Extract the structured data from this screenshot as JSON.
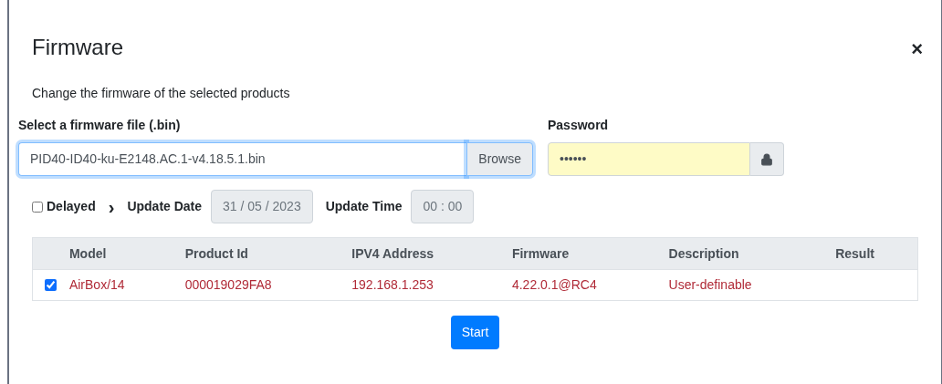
{
  "dialog": {
    "title": "Firmware",
    "close": "×",
    "description": "Change the firmware of the selected products"
  },
  "file": {
    "label": "Select a firmware file (.bin)",
    "value": "PID40-ID40-ku-E2148.AC.1-v4.18.5.1.bin",
    "button": "Browse"
  },
  "password": {
    "label": "Password",
    "value": "••••••"
  },
  "schedule": {
    "delayed": {
      "label": "Delayed",
      "checked": false
    },
    "arrow": "›",
    "date_label": "Update Date",
    "date": "31 / 05 / 2023",
    "time_label": "Update Time",
    "time": "00 : 00"
  },
  "table": {
    "columns": [
      "Model",
      "Product Id",
      "IPV4 Address",
      "Firmware",
      "Description",
      "Result"
    ],
    "rows": [
      {
        "selected": true,
        "cells": [
          "AirBox/14",
          "000019029FA8",
          "192.168.1.253",
          "4.22.0.1@RC4",
          "User-definable",
          ""
        ]
      }
    ]
  },
  "start_button": "Start"
}
